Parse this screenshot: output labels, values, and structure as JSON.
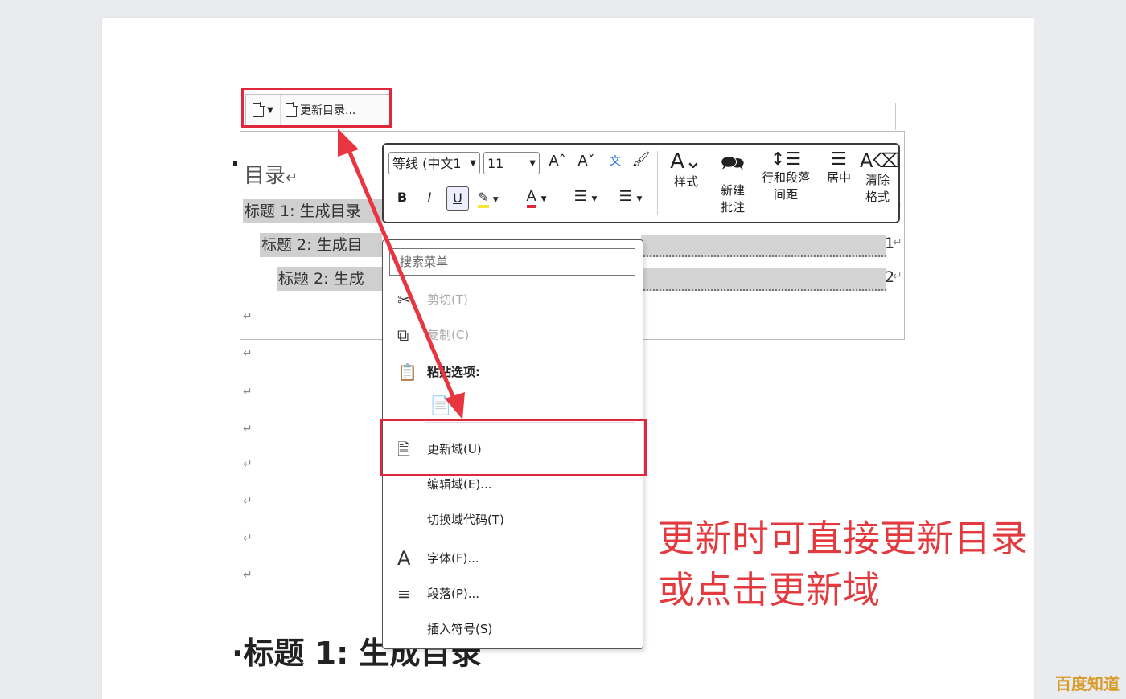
{
  "toc_toolbar": {
    "update_label": "更新目录..."
  },
  "toc": {
    "title": "目录",
    "entries": [
      {
        "text": "标题 1:  生成目录",
        "page": ""
      },
      {
        "text": "标题 2:  生成目",
        "page": "1"
      },
      {
        "text": "标题 2:  生成",
        "page": "2"
      }
    ]
  },
  "mini_toolbar": {
    "font_name": "等线 (中文1",
    "font_size": "11",
    "grow_font": "Aˆ",
    "shrink_font": "Aˇ",
    "bold": "B",
    "italic": "I",
    "underline": "U",
    "font_color": "A",
    "styles_label": "样式",
    "new_comment_label": "新建\n批注",
    "line_spacing_label": "行和段落\n间距",
    "center_label": "居中",
    "clear_format_label": "清除\n格式"
  },
  "context_menu": {
    "search_placeholder": "搜索菜单",
    "items": [
      {
        "label": "剪切(T)",
        "enabled": false
      },
      {
        "label": "复制(C)",
        "enabled": false
      },
      {
        "label": "粘贴选项:",
        "enabled": true
      },
      {
        "label": "更新域(U)",
        "enabled": true
      },
      {
        "label": "编辑域(E)...",
        "enabled": true
      },
      {
        "label": "切换域代码(T)",
        "enabled": true
      },
      {
        "label": "字体(F)...",
        "enabled": true
      },
      {
        "label": "段落(P)...",
        "enabled": true
      },
      {
        "label": "插入符号(S)",
        "enabled": true
      }
    ]
  },
  "annotation": {
    "line1": "更新时可直接更新目录",
    "line2": "或点击更新域",
    "color": "#e23a3e"
  },
  "document": {
    "heading": "标题 1:  生成目录"
  },
  "watermark": "百度知道",
  "return_mark": "↵",
  "colors": {
    "highlight_red": "#e0283c",
    "arrow_red": "#e8353f",
    "watermark": "#d89b28"
  }
}
